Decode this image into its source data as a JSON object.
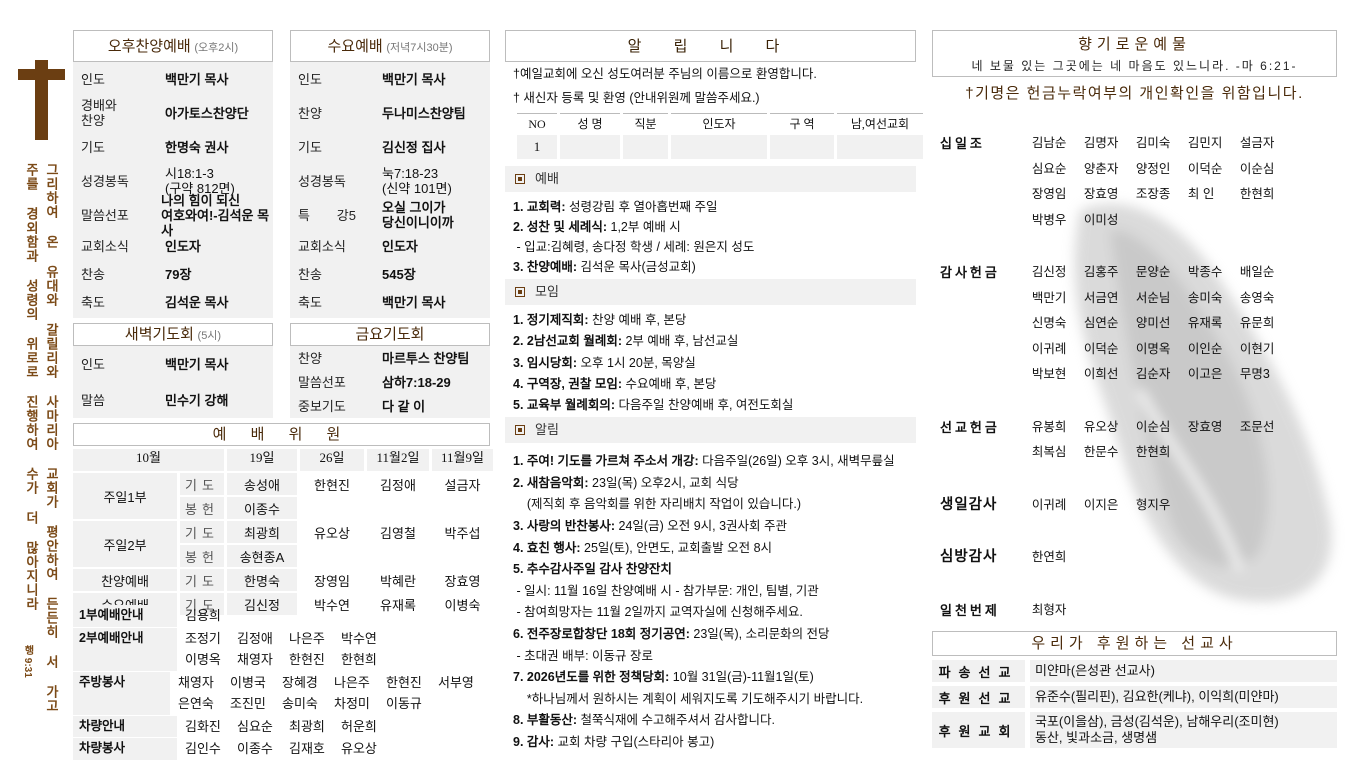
{
  "sidebar": {
    "verse_col1": "그리하여 온 유대와 갈릴리와 사마리아 교회가 평안하여 든든히 서 가고",
    "verse_col2": "주를 경외함과 성령의 위로로 진행하여 수가 더 많아지니라",
    "verse_ref": "행 9:31",
    "colors": {
      "cross": "#6b3e12"
    }
  },
  "afternoon": {
    "title": "오후찬양예배",
    "time": "(오후2시)",
    "rows": [
      {
        "label": "인도",
        "value": "백만기 목사"
      },
      {
        "label": "경배와 찬양",
        "value": "아가토스찬양단"
      },
      {
        "label": "기도",
        "value": "한명숙 권사"
      },
      {
        "label": "성경봉독",
        "value": " 시18:1-3\n(구약 812면)",
        "plain": true
      },
      {
        "label": "말씀선포",
        "value": "나의 힘이 되신\n여호와여!-김석운 목사"
      },
      {
        "label": "교회소식",
        "value": "인도자"
      },
      {
        "label": "찬송",
        "value": "79장"
      },
      {
        "label": "축도",
        "value": "김석운 목사"
      }
    ]
  },
  "wednesday": {
    "title": "수요예배",
    "time": "(저녁7시30분)",
    "rows": [
      {
        "label": "인도",
        "value": "백만기 목사"
      },
      {
        "label": "찬양",
        "value": "두나미스찬양팀"
      },
      {
        "label": "기도",
        "value": "김신정 집사"
      },
      {
        "label": "성경봉독",
        "value": " 눅7:18-23\n(신약 101면)",
        "plain": true
      },
      {
        "label": "특 강5",
        "value": "오실 그이가\n당신이니이까"
      },
      {
        "label": "교회소식",
        "value": "인도자"
      },
      {
        "label": "찬송",
        "value": "545장"
      },
      {
        "label": "축도",
        "value": "백만기 목사"
      }
    ]
  },
  "dawn": {
    "title": "새벽기도회",
    "time": "(5시)",
    "rows": [
      {
        "label": "인도",
        "value": "백만기 목사"
      },
      {
        "label": "말씀",
        "value": "민수기 강해"
      }
    ]
  },
  "friday": {
    "title": "금요기도회",
    "rows": [
      {
        "label": "찬양",
        "value": "마르투스 찬양팀"
      },
      {
        "label": "말씀선포",
        "value": "삼하7:18-29"
      },
      {
        "label": "중보기도",
        "value": "다 같 이"
      }
    ]
  },
  "committee": {
    "title": "예 배 위 원",
    "headers": [
      "10월",
      "19일",
      "26일",
      "11월2일",
      "11월9일"
    ],
    "rows": [
      {
        "label": "주일1부",
        "roles": [
          {
            "role": "기도",
            "names": [
              "송성애",
              "한현진",
              "김정애",
              "설금자"
            ]
          },
          {
            "role": "봉헌",
            "names": [
              "이종수",
              "",
              "",
              ""
            ]
          }
        ]
      },
      {
        "label": "주일2부",
        "roles": [
          {
            "role": "기도",
            "names": [
              "최광희",
              "유오상",
              "김영철",
              "박주섭"
            ]
          },
          {
            "role": "봉헌",
            "names": [
              "송현종A",
              "",
              "",
              ""
            ]
          }
        ]
      },
      {
        "label": "찬양예배",
        "roles": [
          {
            "role": "기도",
            "names": [
              "한명숙",
              "장영임",
              "박혜란",
              "장효영"
            ]
          }
        ]
      },
      {
        "label": "수요예배",
        "roles": [
          {
            "role": "기도",
            "names": [
              "김신정",
              "박수연",
              "유재록",
              "이병숙"
            ]
          }
        ]
      }
    ],
    "duties": [
      {
        "label": "1부예배안내",
        "lines": [
          [
            "김용희"
          ]
        ]
      },
      {
        "label": "2부예배안내",
        "lines": [
          [
            "조정기",
            "김정애",
            "나은주",
            "박수연"
          ],
          [
            "이명옥",
            "채영자",
            "한현진",
            "한현희"
          ]
        ]
      },
      {
        "label": "주방봉사",
        "lines": [
          [
            "채영자",
            "이병국",
            "장혜경",
            "나은주",
            "한현진",
            "서부영"
          ],
          [
            "은연숙",
            "조진민",
            "송미숙",
            "차정미",
            "이동규"
          ]
        ]
      },
      {
        "label": "차량안내",
        "lines": [
          [
            "김화진",
            "심요순",
            "최광희",
            "허운희"
          ]
        ]
      },
      {
        "label": "차량봉사",
        "lines": [
          [
            "김인수",
            "이종수",
            "김재호",
            "유오상"
          ]
        ]
      }
    ]
  },
  "notices": {
    "title": "알 립 니 다",
    "welcome": [
      "†예일교회에 오신 성도여러분 주님의 이름으로 환영합니다.",
      "†  새신자 등록 및 환영 (안내위원께 말씀주세요.)"
    ],
    "newcomer_table": {
      "headers": [
        "NO",
        "성  명",
        "직분",
        "인도자",
        "구 역",
        "남,여선교회"
      ],
      "rows": [
        [
          "1",
          "",
          "",
          "",
          "",
          ""
        ]
      ]
    },
    "sections": [
      {
        "title": "예배",
        "items": [
          {
            "b": "1. 교회력:",
            "t": " 성령강림 후 열아홉번째 주일"
          },
          {
            "b": "2. 성찬 및 세례식:",
            "t": " 1,2부 예배 시"
          },
          {
            "t": " - 입교:김혜령, 송다정 학생 / 세례: 원은지 성도"
          },
          {
            "b": "3. 찬양예배:",
            "t": " 김석운 목사(금성교회)"
          }
        ]
      },
      {
        "title": "모임",
        "items": [
          {
            "b": "1. 정기제직회:",
            "t": " 찬양 예배 후, 본당"
          },
          {
            "b": "2. 2남선교회 월례회:",
            "t": " 2부 예배 후, 남선교실"
          },
          {
            "b": "3. 임시당회:",
            "t": " 오후 1시 20분, 목양실"
          },
          {
            "b": "4. 구역장, 권찰 모임:",
            "t": " 수요예배 후, 본당"
          },
          {
            "b": "5. 교육부 월례회의:",
            "t": " 다음주일 찬양예배 후, 여전도회실"
          }
        ]
      },
      {
        "title": "알림",
        "items": [
          {
            "b": "1. 주여! 기도를 가르쳐 주소서 개강:",
            "t": " 다음주일(26일) 오후 3시, 새벽무릎실"
          },
          {
            "b": "2. 새참음악회:",
            "t": " 23일(목) 오후2시, 교회 식당"
          },
          {
            "t": "    (제직회 후 음악회를 위한 자리배치 작업이 있습니다.)"
          },
          {
            "b": "3. 사랑의 반찬봉사:",
            "t": " 24일(금) 오전 9시, 3권사회 주관"
          },
          {
            "b": "4. 효친 행사:",
            "t": " 25일(토), 안면도, 교회출발 오전 8시"
          },
          {
            "b": "5. 추수감사주일 감사 찬양잔치",
            "t": ""
          },
          {
            "t": " - 일시: 11월 16일 찬양예배 시 - 참가부문: 개인, 팀별, 기관"
          },
          {
            "t": " - 참여희망자는 11월 2일까지 교역자실에 신청해주세요."
          },
          {
            "b": "6. 전주장로합창단 18회 정기공연:",
            "t": " 23일(목), 소리문화의 전당"
          },
          {
            "t": " - 초대권 배부: 이동규 장로"
          },
          {
            "b": "7. 2026년도를 위한 정책당회:",
            "t": " 10월 31일(금)-11월1일(토)"
          },
          {
            "t": "    *하나님께서 원하시는 계획이 세워지도록 기도해주시기 바랍니다."
          },
          {
            "b": "8. 부활동산:",
            "t": " 철쭉식재에 수고해주셔서 감사합니다."
          },
          {
            "b": "9. 감사:",
            "t": " 교회 차량 구입(스타리아 봉고)"
          }
        ]
      }
    ]
  },
  "offering": {
    "title": "향기로운예물",
    "verse": "네 보물 있는 그곳에는 네 마음도 있느니라. -마 6:21-",
    "note": "†기명은 헌금누락여부의 개인확인을 위함입니다.",
    "categories": [
      {
        "label": "십일조",
        "names": [
          "김남순",
          "김명자",
          "김미숙",
          "김민지",
          "설금자",
          "심요순",
          "양춘자",
          "양정인",
          "이덕순",
          "이순심",
          "장영임",
          "장효영",
          "조장종",
          "최 인",
          "한현희",
          "박병우",
          "이미성"
        ]
      },
      {
        "label": "감사헌금",
        "names": [
          "김신정",
          "김홍주",
          "문양순",
          "박종수",
          "배일순",
          "백만기",
          "서금연",
          "서순님",
          "송미숙",
          "송영숙",
          "신명숙",
          "심연순",
          "양미선",
          "유재록",
          "유문희",
          "이귀례",
          "이덕순",
          "이명옥",
          "이인순",
          "이현기",
          "박보현",
          "이희선",
          "김순자",
          "이고은",
          "무명3"
        ]
      },
      {
        "label": "선교헌금",
        "names": [
          "유봉희",
          "유오상",
          "이순심",
          "장효영",
          "조문선",
          "최복심",
          "한문수",
          "한현희"
        ]
      },
      {
        "label": "생일감사",
        "big": true,
        "names": [
          "이귀례",
          "이지은",
          "형지우"
        ]
      },
      {
        "label": "심방감사",
        "big": true,
        "names": [
          "한연희"
        ]
      },
      {
        "label": "일천번제",
        "names": [
          "최형자"
        ]
      }
    ]
  },
  "missions": {
    "title": "우리가 후원하는 선교사",
    "rows": [
      {
        "label": "파송선교",
        "value": "미얀마(은성관 선교사)"
      },
      {
        "label": "후원선교",
        "value": "유준수(필리핀), 김요한(케냐), 이익희(미얀마)"
      },
      {
        "label": "후원교회",
        "value": "국포(이을삼), 금성(김석운), 남해우리(조미현)\n동산, 빛과소금, 생명샘"
      }
    ]
  }
}
